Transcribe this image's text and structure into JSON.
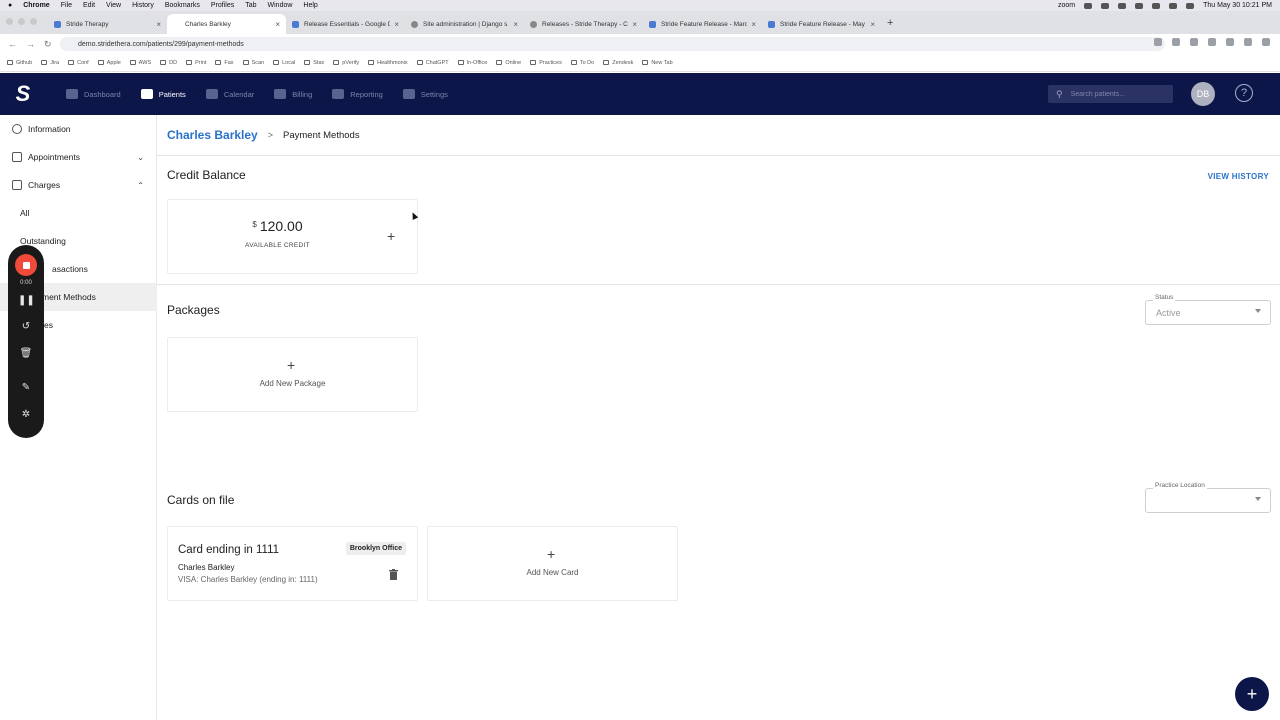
{
  "macos_menu": {
    "apple": "",
    "app": "Chrome",
    "items": [
      "File",
      "Edit",
      "View",
      "History",
      "Bookmarks",
      "Profiles",
      "Tab",
      "Window",
      "Help"
    ],
    "zoom": "zoom",
    "clock": "Thu May 30  10:21 PM"
  },
  "browser": {
    "tabs": [
      {
        "title": "Stride Therapy",
        "active": false
      },
      {
        "title": "Charles Barkley",
        "active": true
      },
      {
        "title": "Release Essentials - Google D",
        "active": false
      },
      {
        "title": "Site administration | Django s",
        "active": false
      },
      {
        "title": "Releases - Stride Therapy - C",
        "active": false
      },
      {
        "title": "Stride Feature Release - Marc",
        "active": false
      },
      {
        "title": "Stride Feature Release - May",
        "active": false
      }
    ],
    "new_tab": "+",
    "url": "demo.stridethera.com/patients/299/payment-methods",
    "bookmarks": [
      "Github",
      "Jira",
      "Conf",
      "Apple",
      "AWS",
      "DD",
      "Print",
      "Fax",
      "Scan",
      "Local",
      "Stax",
      "pVerify",
      "Healthmonix",
      "ChatGPT",
      "In-Office",
      "Online",
      "Practices",
      "To Do",
      "Zendesk",
      "New Tab"
    ]
  },
  "nav": {
    "logo": "S",
    "items": [
      {
        "label": "Dashboard",
        "icon": "dashboard-icon",
        "active": false
      },
      {
        "label": "Patients",
        "icon": "patients-icon",
        "active": true
      },
      {
        "label": "Calendar",
        "icon": "calendar-icon",
        "active": false
      },
      {
        "label": "Billing",
        "icon": "billing-icon",
        "active": false
      },
      {
        "label": "Reporting",
        "icon": "reporting-icon",
        "active": false
      },
      {
        "label": "Settings",
        "icon": "settings-icon",
        "active": false
      }
    ],
    "search_placeholder": "Search patients...",
    "avatar_initials": "DB",
    "help": "?"
  },
  "sidebar": {
    "information": "Information",
    "appointments": "Appointments",
    "charges": "Charges",
    "all": "All",
    "outstanding": "Outstanding",
    "transactions": "asactions",
    "payment_methods": "ment Methods",
    "notes": "es"
  },
  "recorder": {
    "time": "0:00"
  },
  "page": {
    "breadcrumb_patient": "Charles Barkley",
    "breadcrumb_sep": ">",
    "breadcrumb_current": "Payment Methods",
    "credit_balance_title": "Credit Balance",
    "view_history": "VIEW HISTORY",
    "credit_currency": "$",
    "credit_amount": "120.00",
    "credit_label": "AVAILABLE CREDIT",
    "packages_title": "Packages",
    "status_label": "Status",
    "status_value": "Active",
    "add_package": "Add New Package",
    "cards_title": "Cards on file",
    "practice_location_label": "Practice Location",
    "practice_location_value": "",
    "card": {
      "title": "Card ending in 1111",
      "location": "Brooklyn Office",
      "name": "Charles Barkley",
      "desc": "VISA: Charles Barkley (ending in: 1111)"
    },
    "add_card": "Add New Card",
    "plus": "+"
  },
  "colors": {
    "nav_bg": "#0d1648",
    "link": "#2a73c9",
    "record": "#f04a3a"
  }
}
